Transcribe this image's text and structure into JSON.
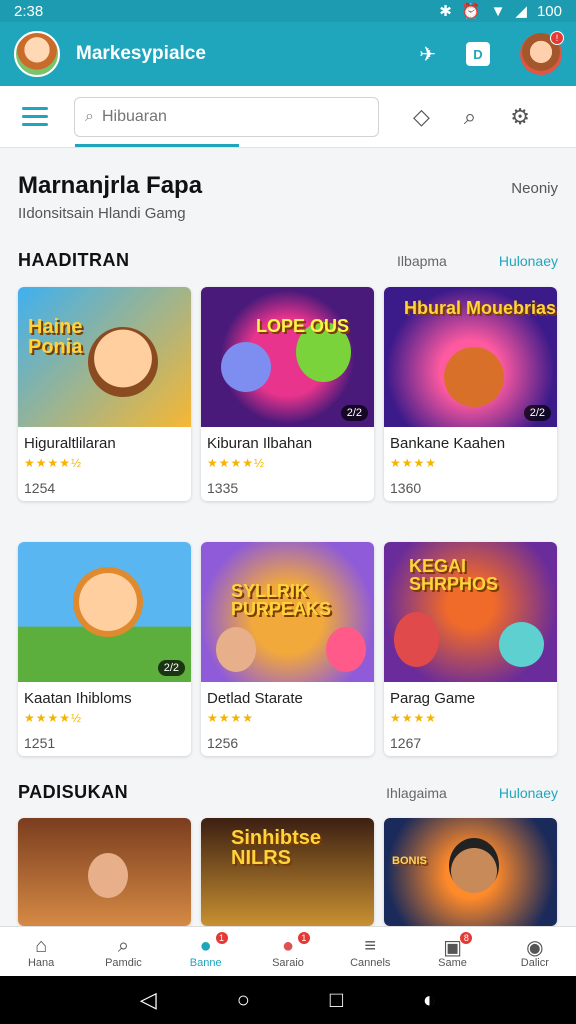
{
  "status": {
    "time": "2:38",
    "battery": "100"
  },
  "header": {
    "app_title": "Markesypialce",
    "button_label": "D"
  },
  "search": {
    "placeholder": "Hibuaran"
  },
  "page": {
    "title": "Marnanjrla Fapa",
    "subtitle": "IIdonsitsain  Hlandi   Gamg",
    "nearby": "Neoniy"
  },
  "sections": [
    {
      "title": "HAADITRAN",
      "mid": "Ilbapma",
      "link": "Hulonaey",
      "cards": [
        {
          "name": "Higuraltlilaran",
          "stars": "★★★★½",
          "count": "1254",
          "art": "Haine Ponia",
          "pill": "",
          "c1": "#3fb0f0",
          "c2": "#f7b733"
        },
        {
          "name": "Kiburan Ilbahan",
          "stars": "★★★★½",
          "count": "1335",
          "art": "LOPE OUS",
          "pill": "2/2",
          "c1": "#4a1a7a",
          "c2": "#e8348c"
        },
        {
          "name": "Bankane Kaahen",
          "stars": "★★★★",
          "count": "1360",
          "art": "Hbural Mouebrias",
          "pill": "2/2",
          "c1": "#3b1a8a",
          "c2": "#ff5aa0"
        }
      ]
    },
    {
      "title": "",
      "mid": "",
      "link": "",
      "cards": [
        {
          "name": "Kaatan Ihibloms",
          "stars": "★★★★½",
          "count": "1251",
          "art": "",
          "pill": "2/2",
          "c1": "#59b6f0",
          "c2": "#5cae3d"
        },
        {
          "name": "Detlad Starate",
          "stars": "★★★★",
          "count": "1256",
          "art": "SYLLRIK PURPEAKS",
          "pill": "",
          "c1": "#8f5bd8",
          "c2": "#f2a93b"
        },
        {
          "name": "Parag Game",
          "stars": "★★★★",
          "count": "1267",
          "art": "KEGAI SHRPHOS",
          "pill": "",
          "c1": "#6a2c9a",
          "c2": "#f06a2a"
        }
      ]
    },
    {
      "title": "PADISUKAN",
      "mid": "Ihlagaima",
      "link": "Hulonaey",
      "cards": [
        {
          "name": "",
          "stars": "",
          "count": "",
          "art": "",
          "pill": "",
          "c1": "#7a3d1e",
          "c2": "#f0a050"
        },
        {
          "name": "",
          "stars": "",
          "count": "",
          "art": "Sinhibtse NILRS",
          "pill": "",
          "c1": "#3c1f12",
          "c2": "#f2b23b"
        },
        {
          "name": "",
          "stars": "",
          "count": "",
          "art": "BONIS",
          "pill": "",
          "c1": "#1a2a5a",
          "c2": "#ff8a2a"
        }
      ]
    }
  ],
  "bottom_nav": [
    {
      "label": "Hana",
      "icon": "home-icon",
      "glyph": "⌂",
      "badge": ""
    },
    {
      "label": "Pamdic",
      "icon": "search-icon",
      "glyph": "⌕",
      "badge": ""
    },
    {
      "label": "Banne",
      "icon": "game-icon",
      "glyph": "●",
      "badge": "1"
    },
    {
      "label": "Saraio",
      "icon": "chat-icon",
      "glyph": "●",
      "badge": "1"
    },
    {
      "label": "Cannels",
      "icon": "list-icon",
      "glyph": "≡",
      "badge": ""
    },
    {
      "label": "Same",
      "icon": "notification-icon",
      "glyph": "▣",
      "badge": "8"
    },
    {
      "label": "Dalicr",
      "icon": "profile-icon",
      "glyph": "👤",
      "badge": ""
    }
  ],
  "colors": {
    "accent": "#1fa6bd",
    "star": "#f4b400"
  }
}
